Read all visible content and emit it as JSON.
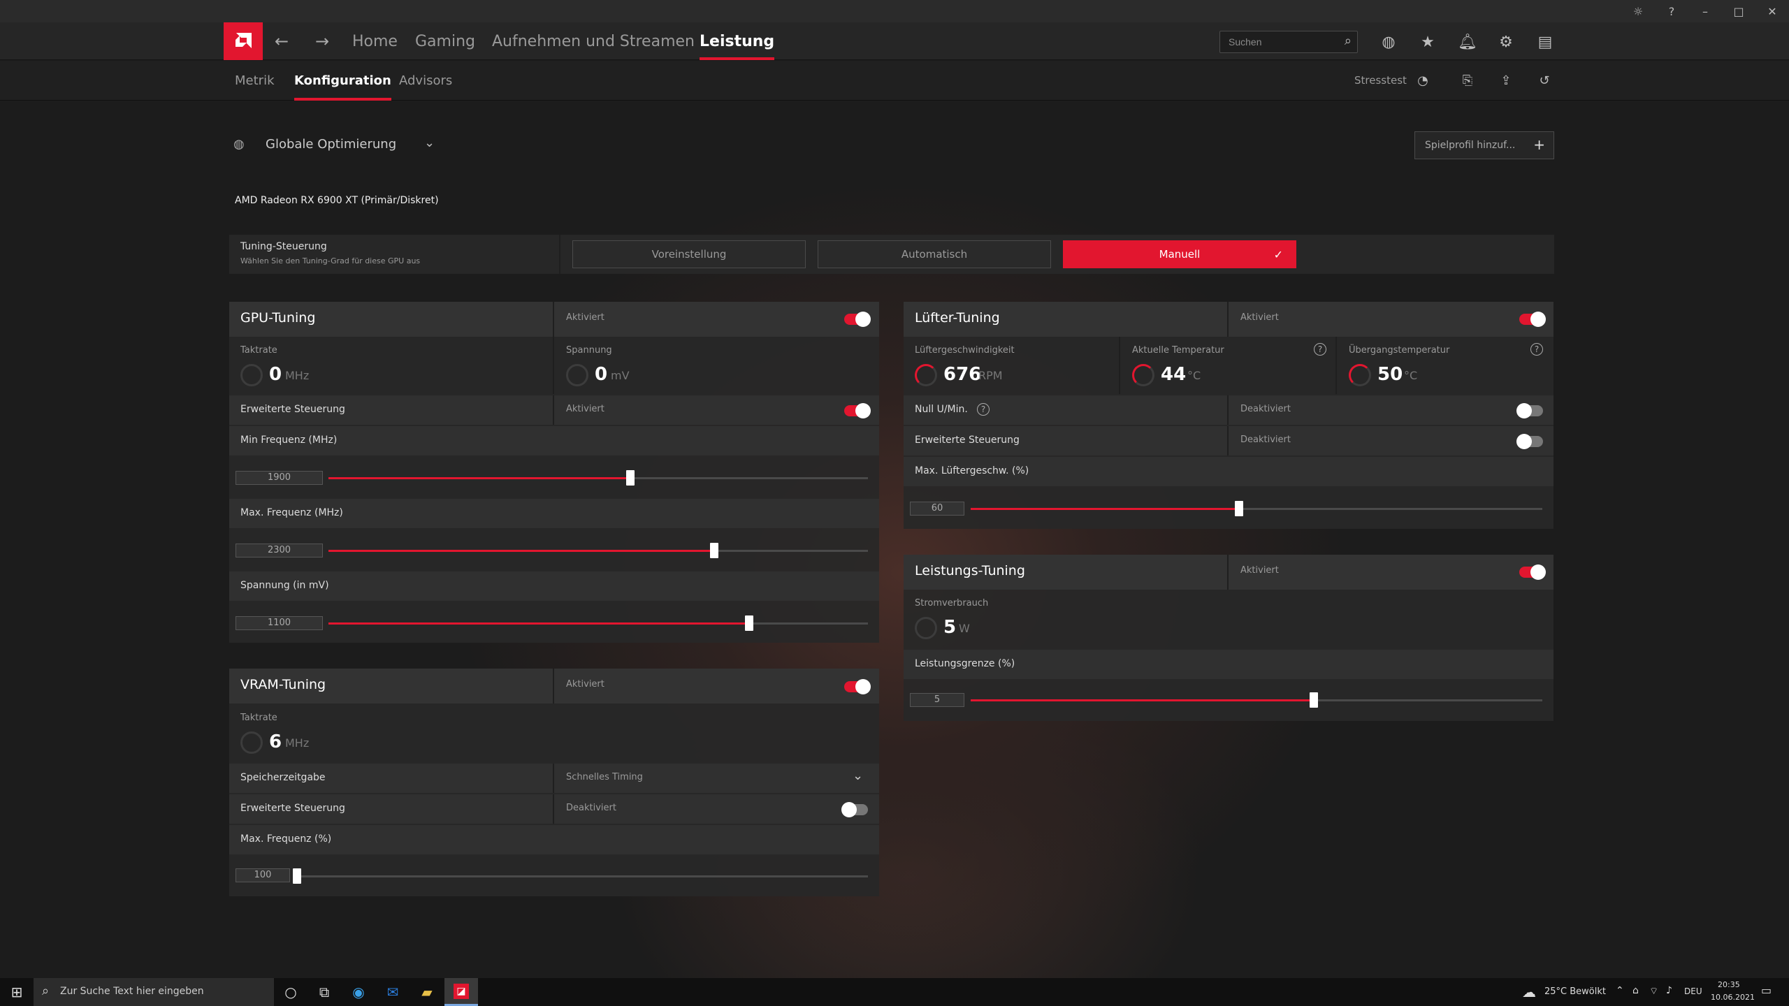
{
  "window": {
    "controls": [
      "debug",
      "help",
      "minimize",
      "maximize",
      "close"
    ]
  },
  "nav": {
    "tabs": [
      "Home",
      "Gaming",
      "Aufnehmen und Streamen",
      "Leistung"
    ],
    "active": "Leistung",
    "search_placeholder": "Suchen"
  },
  "subnav": {
    "tabs": [
      "Metrik",
      "Konfiguration",
      "Advisors"
    ],
    "active": "Konfiguration",
    "stresstest_label": "Stresstest"
  },
  "profile": {
    "label": "Globale Optimierung",
    "add_game_label": "Spielprofil hinzuf..."
  },
  "gpu_name": "AMD Radeon RX 6900 XT (Primär/Diskret)",
  "tuning_control": {
    "title": "Tuning-Steuerung",
    "subtitle": "Wählen Sie den Tuning-Grad für diese GPU aus",
    "options": [
      "Voreinstellung",
      "Automatisch",
      "Manuell"
    ],
    "selected": "Manuell"
  },
  "gpu_tuning": {
    "title": "GPU-Tuning",
    "status": "Aktiviert",
    "enabled": true,
    "clock_label": "Taktrate",
    "clock_value": "0",
    "clock_unit": "MHz",
    "voltage_label": "Spannung",
    "voltage_value": "0",
    "voltage_unit": "mV",
    "advanced_label": "Erweiterte Steuerung",
    "advanced_status": "Aktiviert",
    "advanced_enabled": true,
    "sliders": [
      {
        "label": "Min Frequenz (MHz)",
        "value": "1900",
        "fraction": 0.56
      },
      {
        "label": "Max. Frequenz (MHz)",
        "value": "2300",
        "fraction": 0.715
      },
      {
        "label": "Spannung (in mV)",
        "value": "1100",
        "fraction": 0.78
      }
    ]
  },
  "vram_tuning": {
    "title": "VRAM-Tuning",
    "status": "Aktiviert",
    "enabled": true,
    "clock_label": "Taktrate",
    "clock_value": "6",
    "clock_unit": "MHz",
    "timing_label": "Speicherzeitgabe",
    "timing_value": "Schnelles Timing",
    "advanced_label": "Erweiterte Steuerung",
    "advanced_status": "Deaktiviert",
    "advanced_enabled": false,
    "slider": {
      "label": "Max. Frequenz (%)",
      "value": "100",
      "fraction": 0.0
    }
  },
  "fan_tuning": {
    "title": "Lüfter-Tuning",
    "status": "Aktiviert",
    "enabled": true,
    "speed_label": "Lüftergeschwindigkeit",
    "speed_value": "676",
    "speed_unit": "RPM",
    "temp_label": "Aktuelle Temperatur",
    "temp_value": "44",
    "temp_unit": "°C",
    "junction_label": "Übergangstemperatur",
    "junction_value": "50",
    "junction_unit": "°C",
    "zero_rpm_label": "Null U/Min.",
    "zero_rpm_status": "Deaktiviert",
    "zero_rpm_enabled": false,
    "advanced_label": "Erweiterte Steuerung",
    "advanced_status": "Deaktiviert",
    "advanced_enabled": false,
    "slider": {
      "label": "Max. Lüftergeschw. (%)",
      "value": "60",
      "fraction": 0.47
    }
  },
  "power_tuning": {
    "title": "Leistungs-Tuning",
    "status": "Aktiviert",
    "enabled": true,
    "power_label": "Stromverbrauch",
    "power_value": "5",
    "power_unit": "W",
    "slider": {
      "label": "Leistungsgrenze (%)",
      "value": "5",
      "fraction": 0.6
    }
  },
  "taskbar": {
    "search_placeholder": "Zur Suche Text hier eingeben",
    "weather": "25°C  Bewölkt",
    "language": "DEU",
    "time": "20:35",
    "date": "10.06.2021"
  },
  "colors": {
    "accent": "#e2162f",
    "background": "#1c1c1c"
  }
}
